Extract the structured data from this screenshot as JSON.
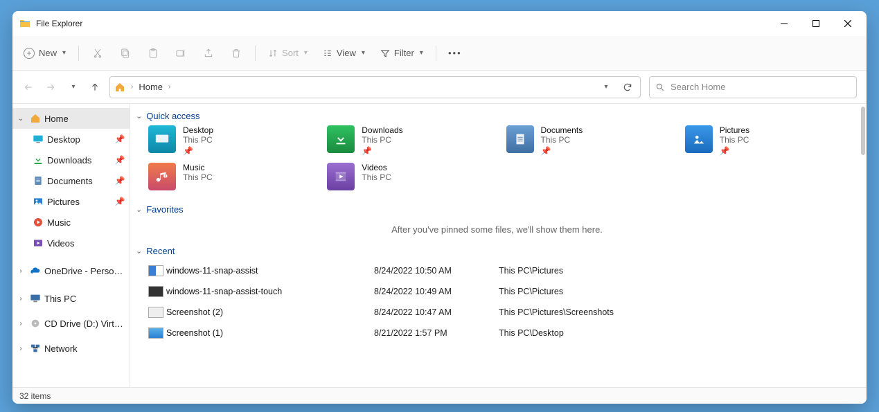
{
  "window": {
    "title": "File Explorer"
  },
  "toolbar": {
    "new_label": "New",
    "sort_label": "Sort",
    "view_label": "View",
    "filter_label": "Filter"
  },
  "address": {
    "location_label": "Home"
  },
  "search": {
    "placeholder": "Search Home"
  },
  "sidebar": {
    "items": [
      {
        "label": "Home",
        "icon": "home",
        "expandable": true,
        "expanded": true,
        "selected": true,
        "pinned": false,
        "indent": 0
      },
      {
        "label": "Desktop",
        "icon": "desktop",
        "expandable": false,
        "pinned": true,
        "indent": 1
      },
      {
        "label": "Downloads",
        "icon": "downloads",
        "expandable": false,
        "pinned": true,
        "indent": 1
      },
      {
        "label": "Documents",
        "icon": "documents",
        "expandable": false,
        "pinned": true,
        "indent": 1
      },
      {
        "label": "Pictures",
        "icon": "pictures",
        "expandable": false,
        "pinned": true,
        "indent": 1
      },
      {
        "label": "Music",
        "icon": "music",
        "expandable": false,
        "pinned": false,
        "indent": 1
      },
      {
        "label": "Videos",
        "icon": "videos",
        "expandable": false,
        "pinned": false,
        "indent": 1
      },
      {
        "label": "OneDrive - Personal",
        "icon": "onedrive",
        "expandable": true,
        "expanded": false,
        "pinned": false,
        "indent": 0
      },
      {
        "label": "This PC",
        "icon": "thispc",
        "expandable": true,
        "expanded": false,
        "pinned": false,
        "indent": 0
      },
      {
        "label": "CD Drive (D:) Virtual",
        "icon": "cd",
        "expandable": true,
        "expanded": false,
        "pinned": false,
        "indent": 0
      },
      {
        "label": "Network",
        "icon": "network",
        "expandable": true,
        "expanded": false,
        "pinned": false,
        "indent": 0
      }
    ]
  },
  "sections": {
    "quick_access": {
      "title": "Quick access",
      "items": [
        {
          "name": "Desktop",
          "location": "This PC",
          "icon": "desktop-big",
          "color": "#18a7c7"
        },
        {
          "name": "Downloads",
          "location": "This PC",
          "icon": "downloads-big",
          "color": "#25a84a"
        },
        {
          "name": "Documents",
          "location": "This PC",
          "icon": "documents-big",
          "color": "#4e8bc7"
        },
        {
          "name": "Pictures",
          "location": "This PC",
          "icon": "pictures-big",
          "color": "#1f7ed6"
        },
        {
          "name": "Music",
          "location": "This PC",
          "icon": "music-big",
          "color": "#e46a3a"
        },
        {
          "name": "Videos",
          "location": "This PC",
          "icon": "videos-big",
          "color": "#7a4fb5"
        }
      ]
    },
    "favorites": {
      "title": "Favorites",
      "empty_text": "After you've pinned some files, we'll show them here."
    },
    "recent": {
      "title": "Recent",
      "rows": [
        {
          "name": "windows-11-snap-assist",
          "date": "8/24/2022 10:50 AM",
          "path": "This PC\\Pictures"
        },
        {
          "name": "windows-11-snap-assist-touch",
          "date": "8/24/2022 10:49 AM",
          "path": "This PC\\Pictures"
        },
        {
          "name": "Screenshot (2)",
          "date": "8/24/2022 10:47 AM",
          "path": "This PC\\Pictures\\Screenshots"
        },
        {
          "name": "Screenshot (1)",
          "date": "8/21/2022 1:57 PM",
          "path": "This PC\\Desktop"
        }
      ]
    }
  },
  "status": {
    "item_count_text": "32 items"
  }
}
